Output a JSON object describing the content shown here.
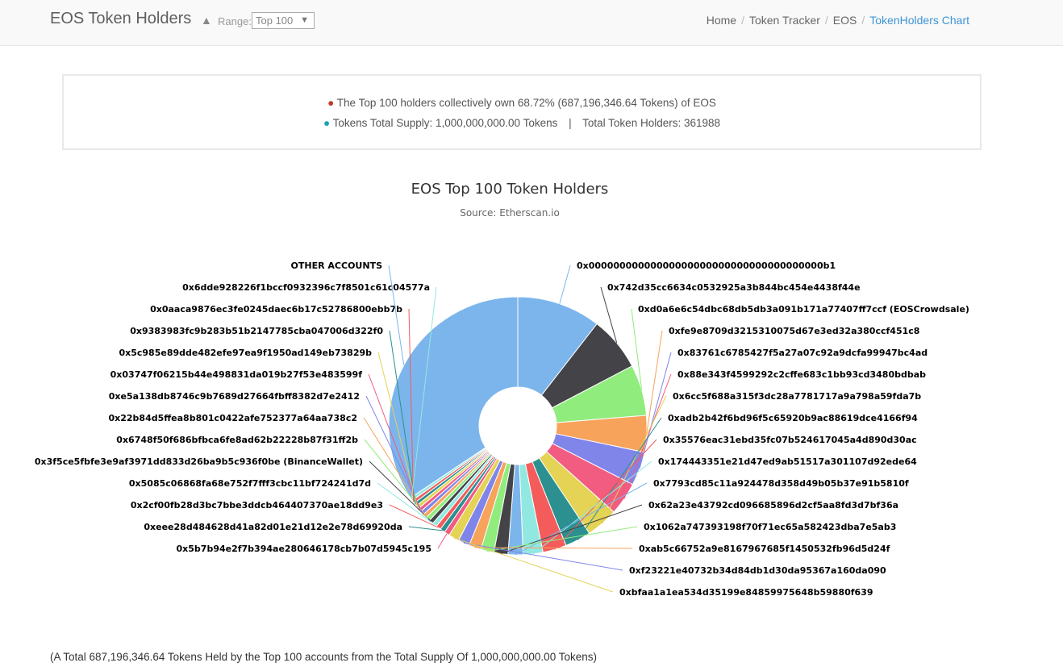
{
  "header": {
    "title": "EOS Token Holders",
    "range_label": "Range:",
    "range_value": "Top 100",
    "breadcrumbs": [
      "Home",
      "Token Tracker",
      "EOS",
      "TokenHolders Chart"
    ]
  },
  "summary": {
    "line1": "The Top 100 holders collectively own 68.72% (687,196,346.64 Tokens) of EOS",
    "supply": "Tokens Total Supply: 1,000,000,000.00 Tokens",
    "divider": "|",
    "holders": "Total Token Holders: 361988"
  },
  "footer": {
    "note": "(A Total 687,196,346.64 Tokens Held by the Top 100 accounts from the Total Supply Of 1,000,000,000.00 Tokens)"
  },
  "chart_data": {
    "type": "pie",
    "title": "EOS Top 100 Token Holders",
    "subtitle": "Source: Etherscan.io",
    "donut": true,
    "slices": [
      {
        "label": "0x00000000000000000000000000000000000000b1",
        "value": 9.55,
        "color": "#7cb5ec"
      },
      {
        "label": "0x742d35cc6634c0532925a3b844bc454e4438f44e",
        "value": 6.2,
        "color": "#434348"
      },
      {
        "label": "0xd0a6e6c54dbc68db5db3a091b171a77407ff7ccf (EOSCrowdsale)",
        "value": 5.8,
        "color": "#90ed7d"
      },
      {
        "label": "0xfe9e8709d3215310075d67e3ed32a380ccf451c8",
        "value": 4.15,
        "color": "#f7a35c"
      },
      {
        "label": "0x83761c6785427f5a27a07c92a9dcfa99947bc4ad",
        "value": 3.85,
        "color": "#8085e9"
      },
      {
        "label": "0x88e343f4599292c2cffe683c1bb93cd3480bdbab",
        "value": 3.75,
        "color": "#f15c80"
      },
      {
        "label": "0x6cc5f688a315f3dc28a7781717a9a798a59fda7b",
        "value": 3.65,
        "color": "#e4d354"
      },
      {
        "label": "0xadb2b42f6bd96f5c65920b9ac88619dce4166f94",
        "value": 2.95,
        "color": "#2b908f"
      },
      {
        "label": "0x35576eac31ebd35fc07b524617045a4d890d30ac",
        "value": 2.7,
        "color": "#f45b5b"
      },
      {
        "label": "0x174443351e21d47ed9ab51517a301107d92ede64",
        "value": 2.25,
        "color": "#91e8e1"
      },
      {
        "label": "0x7793cd85c11a924478d358d49b05b37e91b5810f",
        "value": 1.7,
        "color": "#7cb5ec"
      },
      {
        "label": "0x62a23e43792cd096685896d2cf5aa8fd3d7bf36a",
        "value": 1.6,
        "color": "#434348"
      },
      {
        "label": "0x1062a747393198f70f71ec65a582423dba7e5ab3",
        "value": 1.5,
        "color": "#90ed7d"
      },
      {
        "label": "0xab5c66752a9e8167967685f1450532fb96d5d24f",
        "value": 1.4,
        "color": "#f7a35c"
      },
      {
        "label": "0xf23221e40732b34d84db1d30da95367a160da090",
        "value": 1.3,
        "color": "#8085e9"
      },
      {
        "label": "0xbfaa1a1ea534d35199e84859975648b59880f639",
        "value": 1.2,
        "color": "#e4d354"
      },
      {
        "label": "0x5b7b94e2f7b394ae280646178cb7b07d5945c195",
        "value": 0.62,
        "color": "#f15c80"
      },
      {
        "label": "0xeee28d484628d41a82d01e21d12e2e78d69920da",
        "value": 0.58,
        "color": "#2b908f"
      },
      {
        "label": "0x2cf00fb28d3bc7bbe3ddcb464407370ae18dd9e3",
        "value": 0.55,
        "color": "#f45b5b"
      },
      {
        "label": "0x5085c06868fa68e752f7fff3cbc11bf724241d7d",
        "value": 0.52,
        "color": "#91e8e1"
      },
      {
        "label": "0x3f5ce5fbfe3e9af3971dd833d26ba9b5c936f0be (BinanceWallet)",
        "value": 0.5,
        "color": "#434348"
      },
      {
        "label": "0x6748f50f686bfbca6fe8ad62b22228b87f31ff2b",
        "value": 0.48,
        "color": "#90ed7d"
      },
      {
        "label": "0x22b84d5ffea8b801c0422afe752377a64aa738c2",
        "value": 0.46,
        "color": "#f7a35c"
      },
      {
        "label": "0xe5a138db8746c9b7689d27664fbff8382d7e2412",
        "value": 0.44,
        "color": "#8085e9"
      },
      {
        "label": "0x03747f06215b44e498831da019b27f53e483599f",
        "value": 0.42,
        "color": "#f15c80"
      },
      {
        "label": "0x5c985e89dde482efe97ea9f1950ad149eb73829b",
        "value": 0.4,
        "color": "#e4d354"
      },
      {
        "label": "0x9383983fc9b283b51b2147785cba047006d322f0",
        "value": 0.38,
        "color": "#2b908f"
      },
      {
        "label": "0x0aaca9876ec3fe0245daec6b17c52786800ebb7b",
        "value": 0.36,
        "color": "#f45b5b"
      },
      {
        "label": "0x6dde928226f1bccf0932396c7f8501c61c04577a",
        "value": 0.35,
        "color": "#91e8e1"
      },
      {
        "label": "OTHER ACCOUNTS",
        "value": 31.28,
        "color": "#7cb5ec"
      }
    ]
  }
}
